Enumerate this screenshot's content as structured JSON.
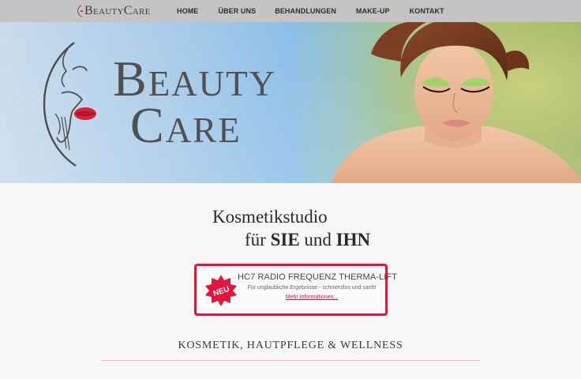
{
  "header": {
    "logo_text": "BeautyCare",
    "menu": [
      {
        "label": "HOME"
      },
      {
        "label": "ÜBER UNS"
      },
      {
        "label": "BEHANDLUNGEN"
      },
      {
        "label": "MAKE-UP"
      },
      {
        "label": "KONTAKT"
      }
    ]
  },
  "hero": {
    "logo_line1": "Beauty",
    "logo_line2": "Care",
    "accent_color": "#e2163c"
  },
  "intro": {
    "line1": "Kosmetikstudio",
    "line2_prefix": "für ",
    "line2_bold1": "SIE",
    "line2_mid": " und ",
    "line2_bold2": "IHN"
  },
  "promo": {
    "badge": "NEU",
    "title": "HC7 RADIO FREQUENZ THERMA-LIFT",
    "subtitle": "Für unglaubliche Ergebnisse - schmerzlos und sanft!",
    "link": "Mehr Informationen..."
  },
  "section": {
    "heading": "KOSMETIK, HAUTPFLEGE & WELLNESS"
  }
}
